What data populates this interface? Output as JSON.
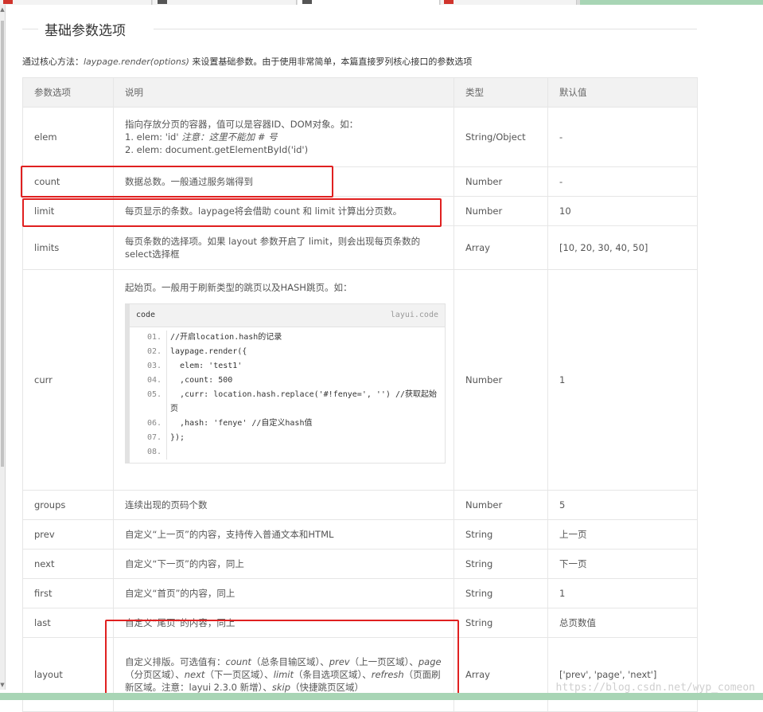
{
  "section_title": "基础参数选项",
  "intro": {
    "prefix": "通过核心方法：",
    "method": "laypage.render(options)",
    "suffix": " 来设置基础参数。由于使用非常简单，本篇直接罗列核心接口的参数选项"
  },
  "table": {
    "headers": [
      "参数选项",
      "说明",
      "类型",
      "默认值"
    ],
    "rows": [
      {
        "name": "elem",
        "type": "String/Object",
        "default": "-"
      },
      {
        "name": "count",
        "desc": "数据总数。一般通过服务端得到",
        "type": "Number",
        "default": "-"
      },
      {
        "name": "limit",
        "desc": "每页显示的条数。laypage将会借助 count 和 limit 计算出分页数。",
        "type": "Number",
        "default": "10"
      },
      {
        "name": "limits",
        "desc": "每页条数的选择项。如果 layout 参数开启了 limit，则会出现每页条数的select选择框",
        "type": "Array",
        "default": "[10, 20, 30, 40, 50]"
      },
      {
        "name": "curr",
        "desc": "起始页。一般用于刷新类型的跳页以及HASH跳页。如：",
        "type": "Number",
        "default": "1"
      },
      {
        "name": "groups",
        "desc": "连续出现的页码个数",
        "type": "Number",
        "default": "5"
      },
      {
        "name": "prev",
        "desc": "自定义“上一页”的内容，支持传入普通文本和HTML",
        "type": "String",
        "default": "上一页"
      },
      {
        "name": "next",
        "desc": "自定义“下一页”的内容，同上",
        "type": "String",
        "default": "下一页"
      },
      {
        "name": "first",
        "desc": "自定义“首页”的内容，同上",
        "type": "String",
        "default": "1"
      },
      {
        "name": "last",
        "desc": "自定义“尾页”的内容，同上",
        "type": "String",
        "default": "总页数值"
      },
      {
        "name": "layout",
        "type": "Array",
        "default": "['prev', 'page', 'next']"
      }
    ],
    "elem_desc": {
      "line1": "指向存放分页的容器，值可以是容器ID、DOM对象。如：",
      "line2_prefix": "1. elem: 'id' ",
      "line2_em": "注意：这里不能加 # 号",
      "line3": "2. elem: document.getElementById('id')"
    },
    "layout_desc": {
      "t1": "自定义排版。可选值有：",
      "c1": "count",
      "t2": "（总条目输区域）、",
      "c2": "prev",
      "t3": "（上一页区域）、",
      "c3": "page",
      "t4": "（分页区域）、",
      "c4": "next",
      "t5": "（下一页区域）、",
      "c5": "limit",
      "t6": "（条目选项区域）、",
      "c6": "refresh",
      "t7": "（页面刷新区域。注意：layui 2.3.0 新增）、",
      "c7": "skip",
      "t8": "（快捷跳页区域）"
    }
  },
  "code": {
    "title": "code",
    "brand": "layui.code",
    "lines": [
      {
        "n": "01.",
        "t": "//开启location.hash的记录"
      },
      {
        "n": "02.",
        "t": "laypage.render({"
      },
      {
        "n": "03.",
        "t": "  elem: 'test1'"
      },
      {
        "n": "04.",
        "t": "  ,count: 500"
      },
      {
        "n": "05.",
        "t": "  ,curr: location.hash.replace('#!fenye=', '') //获取起始页"
      },
      {
        "n": "06.",
        "t": "  ,hash: 'fenye' //自定义hash值"
      },
      {
        "n": "07.",
        "t": "});"
      },
      {
        "n": "08.",
        "t": ""
      }
    ]
  },
  "watermark": "https://blog.csdn.net/wyp_comeon",
  "colors": {
    "highlight": "#e02020",
    "accent_bar": "#a8d5b5"
  }
}
